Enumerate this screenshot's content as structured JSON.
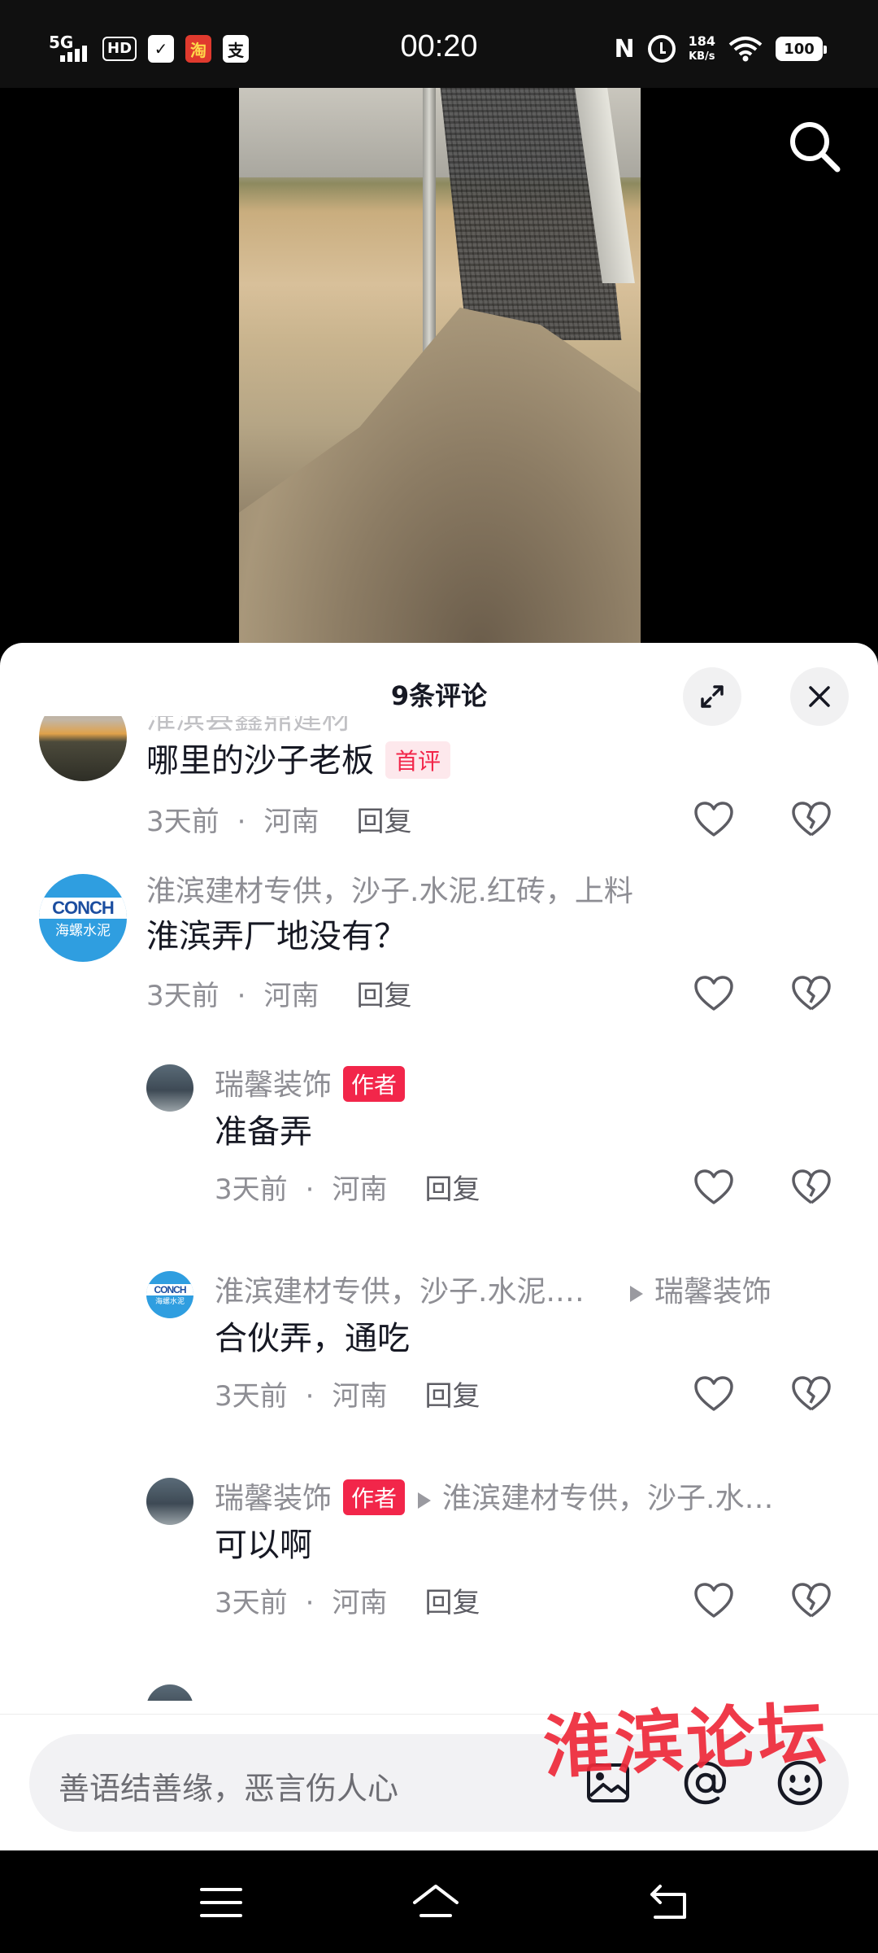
{
  "status_bar": {
    "network": "5G",
    "hd": "HD",
    "time": "00:20",
    "speed_value": "184",
    "speed_unit": "KB/s",
    "battery": "100"
  },
  "video": {
    "search_icon": "search-icon"
  },
  "sheet": {
    "title": "9条评论",
    "expand_icon": "expand-icon",
    "close_icon": "close-icon"
  },
  "comments": [
    {
      "name": "淮滨县鑫鼎建材",
      "text": "哪里的沙子老板",
      "badge": "首评",
      "time": "3天前",
      "location": "河南",
      "reply": "回复"
    },
    {
      "name": "淮滨建材专供，沙子.水泥.红砖，上料",
      "text": "淮滨弄厂地没有？",
      "avatar_line1": "CONCH",
      "avatar_line2": "海螺水泥",
      "time": "3天前",
      "location": "河南",
      "reply": "回复"
    }
  ],
  "replies": [
    {
      "name": "瑞馨装饰",
      "badge": "作者",
      "text": "准备弄",
      "time": "3天前",
      "location": "河南",
      "reply": "回复"
    },
    {
      "name": "淮滨建材专供，沙子.水泥.…",
      "target": "瑞馨装饰",
      "avatar_line1": "CONCH",
      "avatar_line2": "海螺水泥",
      "text": "合伙弄，通吃",
      "time": "3天前",
      "location": "河南",
      "reply": "回复"
    },
    {
      "name": "瑞馨装饰",
      "badge": "作者",
      "target": "淮滨建材专供，沙子.水…",
      "text": "可以啊",
      "time": "3天前",
      "location": "河南",
      "reply": "回复"
    }
  ],
  "separator_dot": "·",
  "input": {
    "placeholder": "善语结善缘，恶言伤人心",
    "icons": [
      "image-icon",
      "at-icon",
      "emoji-icon"
    ]
  },
  "watermark": "淮滨论坛",
  "colors": {
    "accent": "#f2264a",
    "sheet_bg": "#ffffff",
    "muted_text": "#8e8e94"
  },
  "nav": {
    "icons": [
      "menu-icon",
      "home-icon",
      "back-icon"
    ]
  }
}
